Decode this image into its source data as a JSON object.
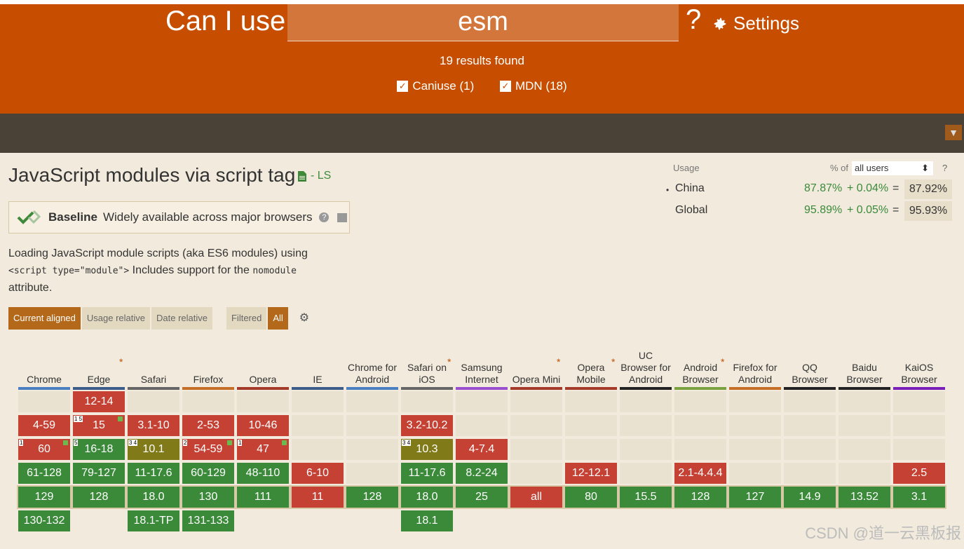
{
  "header": {
    "brand": "Can I use",
    "search_value": "esm",
    "help": "?",
    "settings_label": "Settings",
    "results": "19 results found",
    "filters": [
      {
        "label": "Caniuse (1)",
        "checked": true
      },
      {
        "label": "MDN (18)",
        "checked": true
      }
    ]
  },
  "feature": {
    "title": "JavaScript modules via script tag",
    "status": "- LS",
    "baseline_label": "Baseline",
    "baseline_text": "Widely available across major browsers",
    "desc_a": "Loading JavaScript module scripts (aka ES6 modules) using",
    "code1": "<script type=\"module\">",
    "desc_b": "Includes support for the",
    "code2": "nomodule",
    "desc_c": "attribute."
  },
  "usage": {
    "label": "Usage",
    "pct_of": "% of",
    "select": "all users",
    "help": "?",
    "rows": [
      {
        "name": "China",
        "a": "87.87%",
        "b": "+ 0.04%",
        "eq": "=",
        "total": "87.92%"
      },
      {
        "name": "Global",
        "a": "95.89%",
        "b": "+ 0.05%",
        "eq": "=",
        "total": "95.93%"
      }
    ]
  },
  "tabs": [
    "Current aligned",
    "Usage relative",
    "Date relative",
    "Filtered",
    "All"
  ],
  "browsers": [
    {
      "name": "Chrome",
      "color": "#4a7fc1",
      "cells": [
        "",
        "4-59",
        "60",
        "61-128",
        "129",
        "130-132"
      ],
      "states": [
        "u",
        "n",
        "n",
        "y",
        "y",
        "y"
      ],
      "notes": {
        "2": "1"
      },
      "flags": [
        2
      ]
    },
    {
      "name": "Edge",
      "color": "#3c5d8a",
      "star": true,
      "cells": [
        "12-14",
        "15",
        "16-18",
        "79-127",
        "128",
        ""
      ],
      "states": [
        "n",
        "n",
        "y",
        "y",
        "y",
        "none"
      ],
      "notes": {
        "1": "1 5",
        "2": "5"
      },
      "flags": [
        1
      ]
    },
    {
      "name": "Safari",
      "color": "#666666",
      "cells": [
        "",
        "3.1-10",
        "10.1",
        "11-17.6",
        "18.0",
        "18.1-TP"
      ],
      "states": [
        "u",
        "n",
        "p",
        "y",
        "y",
        "y"
      ],
      "notes": {
        "2": "3 4"
      },
      "flags": []
    },
    {
      "name": "Firefox",
      "color": "#c46e28",
      "cells": [
        "",
        "2-53",
        "54-59",
        "60-129",
        "130",
        "131-133"
      ],
      "states": [
        "u",
        "n",
        "n",
        "y",
        "y",
        "y"
      ],
      "notes": {
        "2": "2"
      },
      "flags": [
        2
      ]
    },
    {
      "name": "Opera",
      "color": "#a33a2a",
      "cells": [
        "",
        "10-46",
        "47",
        "48-110",
        "111",
        ""
      ],
      "states": [
        "u",
        "n",
        "n",
        "y",
        "y",
        "none"
      ],
      "notes": {
        "2": "1"
      },
      "flags": [
        2
      ]
    },
    {
      "name": "IE",
      "color": "#3c5d8a",
      "cells": [
        "",
        "",
        "",
        "6-10",
        "11",
        ""
      ],
      "states": [
        "u",
        "u",
        "u",
        "n",
        "n",
        "none"
      ],
      "notes": {},
      "flags": []
    },
    {
      "name": "Chrome for Android",
      "color": "#4a7fc1",
      "cells": [
        "",
        "",
        "",
        "",
        "128",
        ""
      ],
      "states": [
        "u",
        "u",
        "u",
        "u",
        "y",
        "none"
      ],
      "notes": {},
      "flags": []
    },
    {
      "name": "Safari on iOS",
      "color": "#666666",
      "star": true,
      "cells": [
        "",
        "3.2-10.2",
        "10.3",
        "11-17.6",
        "18.0",
        "18.1"
      ],
      "states": [
        "u",
        "n",
        "p",
        "y",
        "y",
        "y"
      ],
      "notes": {
        "2": "3 4"
      },
      "flags": []
    },
    {
      "name": "Samsung Internet",
      "color": "#9a4fd0",
      "cells": [
        "",
        "",
        "4-7.4",
        "8.2-24",
        "25",
        ""
      ],
      "states": [
        "u",
        "u",
        "n",
        "y",
        "y",
        "none"
      ],
      "notes": {},
      "flags": []
    },
    {
      "name": "Opera Mini",
      "color": "#a33a2a",
      "star": true,
      "cells": [
        "",
        "",
        "",
        "",
        "all",
        ""
      ],
      "states": [
        "u",
        "u",
        "u",
        "u",
        "n",
        "none"
      ],
      "notes": {},
      "flags": []
    },
    {
      "name": "Opera Mobile",
      "color": "#a33a2a",
      "star": true,
      "cells": [
        "",
        "",
        "",
        "12-12.1",
        "80",
        ""
      ],
      "states": [
        "u",
        "u",
        "u",
        "n",
        "y",
        "none"
      ],
      "notes": {},
      "flags": []
    },
    {
      "name": "UC Browser for Android",
      "color": "#222222",
      "cells": [
        "",
        "",
        "",
        "",
        "15.5",
        ""
      ],
      "states": [
        "u",
        "u",
        "u",
        "u",
        "y",
        "none"
      ],
      "notes": {},
      "flags": []
    },
    {
      "name": "Android Browser",
      "color": "#7aa33f",
      "star": true,
      "cells": [
        "",
        "",
        "",
        "2.1-4.4.4",
        "128",
        ""
      ],
      "states": [
        "u",
        "u",
        "u",
        "n",
        "y",
        "none"
      ],
      "notes": {},
      "flags": []
    },
    {
      "name": "Firefox for Android",
      "color": "#c46e28",
      "cells": [
        "",
        "",
        "",
        "",
        "127",
        ""
      ],
      "states": [
        "u",
        "u",
        "u",
        "u",
        "y",
        "none"
      ],
      "notes": {},
      "flags": []
    },
    {
      "name": "QQ Browser",
      "color": "#222222",
      "cells": [
        "",
        "",
        "",
        "",
        "14.9",
        ""
      ],
      "states": [
        "u",
        "u",
        "u",
        "u",
        "y",
        "none"
      ],
      "notes": {},
      "flags": []
    },
    {
      "name": "Baidu Browser",
      "color": "#222222",
      "cells": [
        "",
        "",
        "",
        "",
        "13.52",
        ""
      ],
      "states": [
        "u",
        "u",
        "u",
        "u",
        "y",
        "none"
      ],
      "notes": {},
      "flags": []
    },
    {
      "name": "KaiOS Browser",
      "color": "#7a1fb8",
      "cells": [
        "",
        "",
        "",
        "2.5",
        "3.1",
        ""
      ],
      "states": [
        "u",
        "u",
        "u",
        "n",
        "y",
        "none"
      ],
      "notes": {},
      "flags": []
    }
  ],
  "watermark": "CSDN @道一云黑板报"
}
